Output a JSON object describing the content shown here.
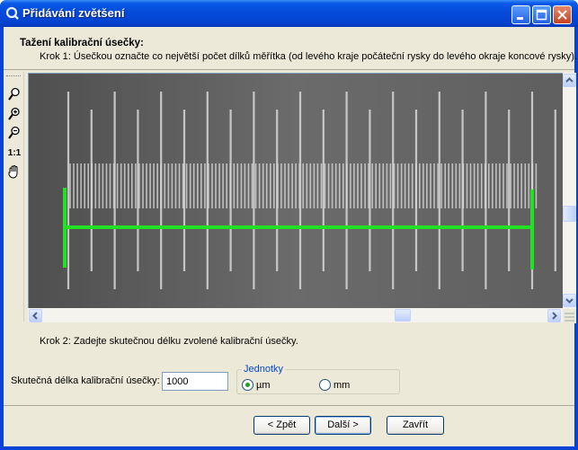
{
  "window": {
    "title": "Přidávání zvětšení",
    "buttons": [
      "minimize",
      "maximize",
      "close"
    ]
  },
  "header": {
    "title": "Tažení kalibrační úsečky:",
    "step1": "Krok 1: Úsečkou označte co největší počet dílků měřítka (od levého kraje počáteční rysky do levého okraje koncové rysky)."
  },
  "toolbar": {
    "tools": [
      {
        "icon": "zoom-icon"
      },
      {
        "icon": "zoom-in-icon"
      },
      {
        "icon": "zoom-out-icon"
      },
      {
        "label": "1:1",
        "icon": "actual-size-icon"
      },
      {
        "icon": "pan-hand-icon"
      }
    ]
  },
  "viewer": {
    "calibration_line_color": "#22e022",
    "scale_tick_color": "#d8d8d8",
    "background_color": "#6a6a6a"
  },
  "step2": "Krok 2: Zadejte skutečnou délku zvolené kalibrační úsečky.",
  "length": {
    "label": "Skutečná délka kalibrační úsečky:",
    "value": "1000"
  },
  "units": {
    "legend": "Jednotky",
    "options": [
      {
        "label": "µm",
        "checked": true
      },
      {
        "label": "mm",
        "checked": false
      }
    ]
  },
  "buttons": {
    "back": "< Zpět",
    "next": "Další >",
    "close": "Zavřít"
  }
}
